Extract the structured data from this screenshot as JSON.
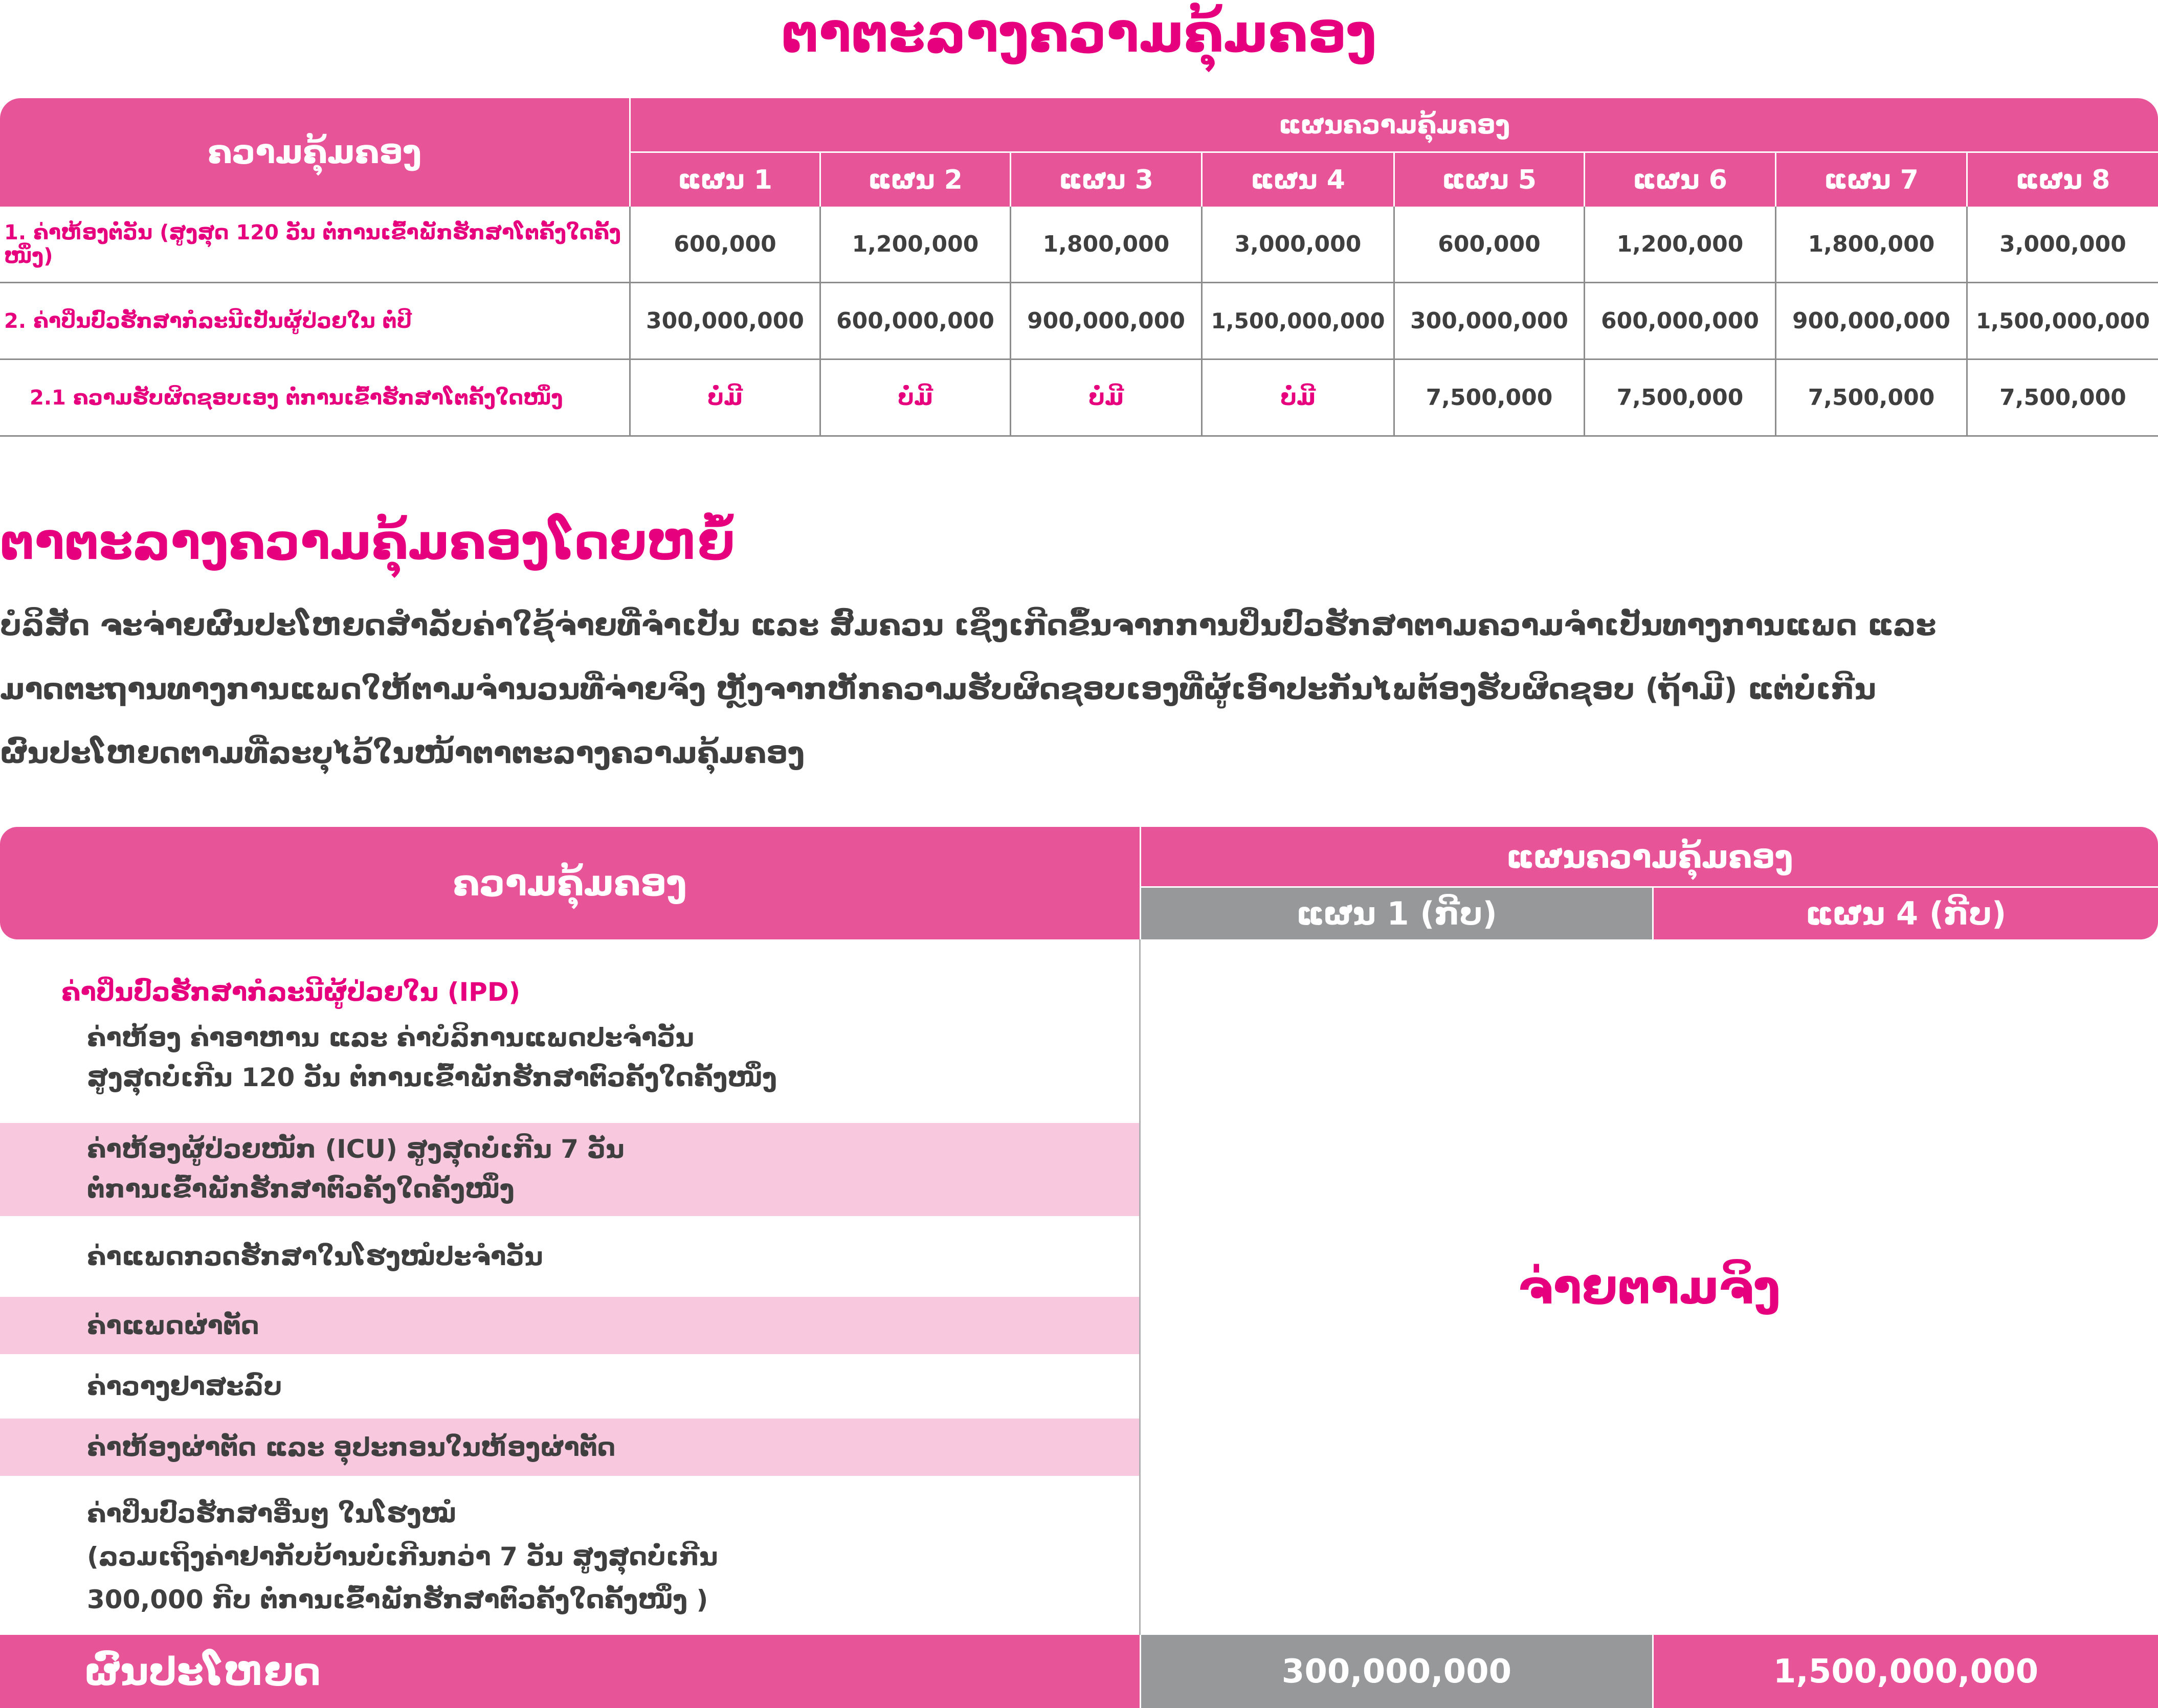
{
  "title": "ຕາຕະລາງຄວາມຄຸ້ມຄອງ",
  "table1": {
    "coverage_header": "ຄວາມຄຸ້ມຄອງ",
    "plan_group_header": "ແຜນຄວາມຄຸ້ມຄອງ",
    "plans": [
      "ແຜນ 1",
      "ແຜນ 2",
      "ແຜນ 3",
      "ແຜນ 4",
      "ແຜນ 5",
      "ແຜນ 6",
      "ແຜນ 7",
      "ແຜນ 8"
    ],
    "rows": [
      {
        "label": "1. ຄ່າຫ້ອງຕໍ່ວັນ (ສູງສຸດ 120 ວັນ ຕໍ່ການເຂົ້າພັກຮັກສາໂຕຄັ້ງໃດຄັ້ງໜຶ່ງ)",
        "values": [
          "600,000",
          "1,200,000",
          "1,800,000",
          "3,000,000",
          "600,000",
          "1,200,000",
          "1,800,000",
          "3,000,000"
        ]
      },
      {
        "label": "2. ຄ່າປິ່ນປົວຮັກສາກໍລະນີເປັນຜູ້ປ່ວຍໃນ ຕໍ່ປີ",
        "values": [
          "300,000,000",
          "600,000,000",
          "900,000,000",
          "1,500,000,000",
          "300,000,000",
          "600,000,000",
          "900,000,000",
          "1,500,000,000"
        ]
      },
      {
        "label": "2.1 ຄວາມຮັບຜິດຊອບເອງ ຕໍ່ການເຂົ້າຮັກສາໂຕຄັ້ງໃດໜຶ່ງ",
        "values": [
          "ບໍ່ມີ",
          "ບໍ່ມີ",
          "ບໍ່ມີ",
          "ບໍ່ມີ",
          "7,500,000",
          "7,500,000",
          "7,500,000",
          "7,500,000"
        ]
      }
    ]
  },
  "summary": {
    "title": "ຕາຕະລາງຄວາມຄຸ້ມຄອງໂດຍຫຍໍ້",
    "paragraph_lines": [
      "ບໍລິສັດ ຈະຈ່າຍຜົນປະໂຫຍດສໍາລັບຄ່າໃຊ້ຈ່າຍທີ່ຈໍາເປັນ ແລະ ສົມຄວນ ເຊິ່ງເກີດຂຶ້ນຈາກການປິ່ນປົວຮັກສາຕາມຄວາມຈໍາເປັນທາງການແພດ ແລະ",
      "ມາດຕະຖານທາງການແພດໃຫ້ຕາມຈໍານວນທີ່ຈ່າຍຈິງ ຫຼັງຈາກຫັກຄວາມຮັບຜິດຊອບເອງທີ່ຜູ້ເອົາປະກັນໄພຕ້ອງຮັບຜິດຊອບ (ຖ້າມີ) ແຕ່ບໍ່ເກີນ",
      "ຜົນປະໂຫຍດຕາມທີ່ລະບຸໄວ້ໃນໜ້າຕາຕະລາງຄວາມຄຸ້ມຄອງ"
    ]
  },
  "table2": {
    "coverage_header": "ຄວາມຄຸ້ມຄອງ",
    "plan_group_header": "ແຜນຄວາມຄຸ້ມຄອງ",
    "plan_a": "ແຜນ 1 (ກີບ)",
    "plan_b": "ແຜນ 4 (ກີບ)",
    "ipd_title": "ຄ່າປິ່ນປົວຮັກສາກໍລະນີຜູ້ປ່ວຍໃນ (IPD)",
    "items": [
      [
        "ຄ່າຫ້ອງ ຄ່າອາຫານ ແລະ ຄ່າບໍລິການແພດປະຈໍາວັນ",
        "ສູງສຸດບໍ່ເກີນ 120 ວັນ ຕໍ່ການເຂົ້າພັກຮັກສາຕົວຄັ້ງໃດຄັ້ງໜຶ່ງ"
      ],
      [
        "ຄ່າຫ້ອງຜູ້ປ່ວຍໜັກ (ICU) ສູງສຸດບໍ່ເກີນ 7 ວັນ",
        "ຕໍ່ການເຂົ້າພັກຮັກສາຕົວຄັ້ງໃດຄັ້ງໜຶ່ງ"
      ],
      [
        "ຄ່າແພດກວດຮັກສາໃນໂຮງໝໍປະຈໍາວັນ"
      ],
      [
        "ຄ່າແພດຜ່າຕັດ"
      ],
      [
        "ຄ່າວາງຢາສະລົບ"
      ],
      [
        "ຄ່າຫ້ອງຜ່າຕັດ ແລະ ອຸປະກອນໃນຫ້ອງຜ່າຕັດ"
      ],
      [
        "ຄ່າປິ່ນປົວຮັກສາອື່ນໆ ໃນໂຮງໝໍ",
        "(ລວມເຖິງຄ່າຢາກັບບ້ານບໍ່ເກີນກວ່າ 7 ວັນ ສູງສຸດບໍ່ເກີນ",
        "300,000 ກີບ ຕໍ່ການເຂົ້າພັກຮັກສາຕົວຄັ້ງໃດຄັ້ງໜຶ່ງ )"
      ]
    ],
    "actual_pay": "ຈ່າຍຕາມຈິງ",
    "benefit_label": "ຜົນປະໂຫຍດ",
    "benefit_plan_a": "300,000,000",
    "benefit_plan_b": "1,500,000,000"
  },
  "colors": {
    "pink_header": "#e85498",
    "accent_text": "#e6007e",
    "grey_header": "#96989a",
    "light_band": "#f7c8de"
  }
}
